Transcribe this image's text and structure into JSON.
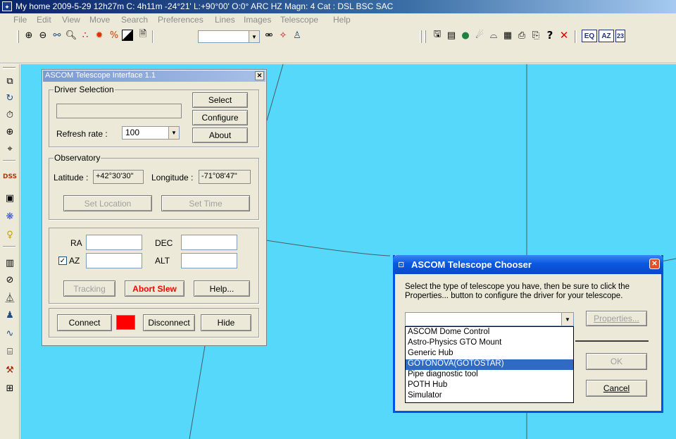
{
  "title_bar": {
    "text": "My home 2009-5-29  12h27m C:  4h11m -24°21' L:+90°00' O:0° ARC HZ  Magn: 4 Cat : DSL BSC SAC"
  },
  "menu": [
    "File",
    "Edit",
    "View",
    "Move",
    "Search",
    "Preferences",
    "Lines",
    "Images",
    "Telescope",
    "Help"
  ],
  "toolbar": {
    "left_icons": [
      "zoom-in-icon",
      "zoom-out-icon",
      "zoom-fit-icon",
      "zoom-icon",
      "constellation-icon",
      "star-icon",
      "planet-icon",
      "color-icon",
      "page-icon"
    ],
    "search_icons": [
      "binoculars-icon",
      "find-star-icon",
      "find-person-icon"
    ],
    "right_icons": [
      "save-icon",
      "notes-icon",
      "planet-globe-icon",
      "comet-icon",
      "dome-icon",
      "calendar-icon",
      "print-icon",
      "printer-settings-icon",
      "help-icon",
      "close-icon"
    ],
    "mode_buttons": [
      "EQ",
      "AZ",
      "23"
    ]
  },
  "sidebar_icons": [
    "copy-icon",
    "refresh-icon",
    "clock-icon",
    "grid-icon",
    "target-icon",
    "dss-icon",
    "image-icon",
    "nebula-icon",
    "pin-icon",
    "list-icon",
    "compass-icon",
    "telescope-icon",
    "person-icon",
    "curve-icon",
    "ruler-icon",
    "tools-icon",
    "add-icon"
  ],
  "ascom_interface": {
    "title": "ASCOM Telescope Interface 1.1",
    "driver_selection": {
      "label": "Driver Selection",
      "driver_name": "",
      "select_label": "Select",
      "configure_label": "Configure",
      "about_label": "About",
      "refresh_rate_label": "Refresh rate :",
      "refresh_rate_value": "100"
    },
    "observatory": {
      "label": "Observatory",
      "latitude_label": "Latitude :",
      "latitude_value": "+42°30'30\"",
      "longitude_label": "Longitude :",
      "longitude_value": "-71°08'47\"",
      "set_location_label": "Set Location",
      "set_time_label": "Set Time"
    },
    "coords": {
      "ra_label": "RA",
      "dec_label": "DEC",
      "az_label": "AZ",
      "alt_label": "ALT",
      "az_checked": true,
      "tracking_label": "Tracking",
      "abort_label": "Abort Slew",
      "help_label": "Help..."
    },
    "connection": {
      "connect_label": "Connect",
      "disconnect_label": "Disconnect",
      "hide_label": "Hide",
      "status_color": "#ff0000"
    }
  },
  "chooser": {
    "title": "ASCOM Telescope Chooser",
    "instructions_line1": "Select the type of telescope you have, then be sure to click the",
    "instructions_line2": "Properties... button to configure the driver for your telescope.",
    "selected_value": "",
    "properties_label": "Properties...",
    "ok_label": "OK",
    "cancel_label": "Cancel",
    "options": [
      {
        "label": "ASCOM Dome Control",
        "selected": false
      },
      {
        "label": "Astro-Physics GTO Mount",
        "selected": false
      },
      {
        "label": "Generic Hub",
        "selected": false
      },
      {
        "label": "GOTONOVA(GOTOSTAR)",
        "selected": true
      },
      {
        "label": "Pipe diagnostic tool",
        "selected": false
      },
      {
        "label": "POTH Hub",
        "selected": false
      },
      {
        "label": "Simulator",
        "selected": false
      }
    ]
  },
  "colors": {
    "sky": "#55d8fa",
    "title_bar": "#0a246a",
    "xp_title": "#0054e3",
    "dialog_bg": "#ece9d8",
    "selection": "#316ac5",
    "abort_text": "#ff0000"
  }
}
